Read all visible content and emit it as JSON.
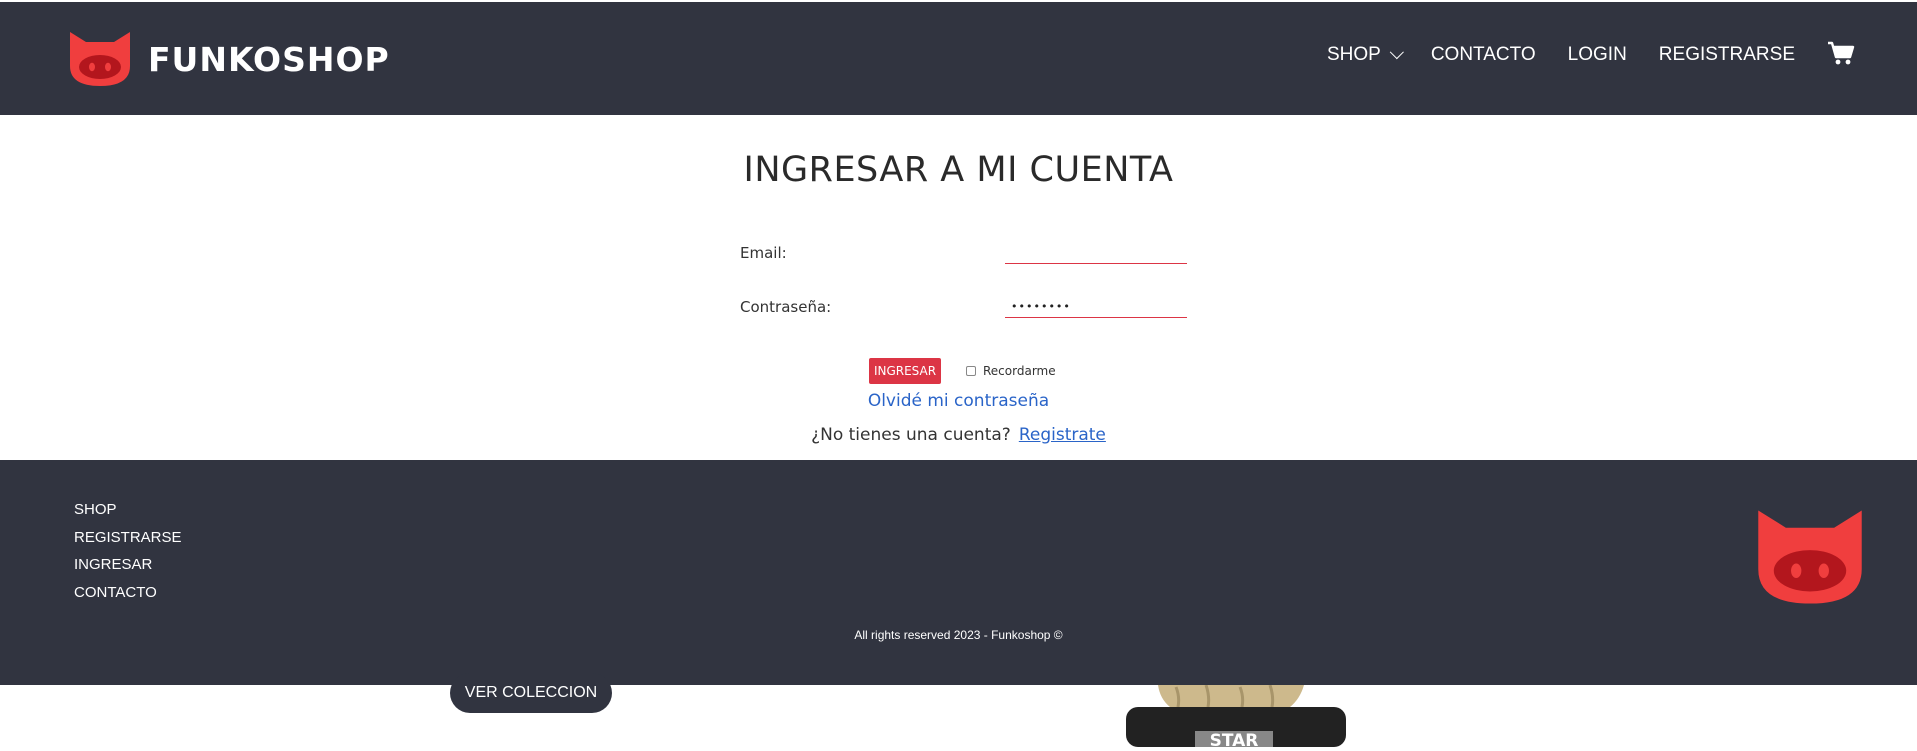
{
  "header": {
    "brand": "FUNKOSHOP",
    "nav": {
      "shop": "SHOP",
      "contacto": "CONTACTO",
      "login": "LOGIN",
      "registrarse": "REGISTRARSE"
    },
    "icons": {
      "logo": "cat-logo-icon",
      "cart": "cart-icon",
      "dropdown": "chevron-down-icon"
    }
  },
  "login": {
    "title": "INGRESAR A MI CUENTA",
    "email_label": "Email:",
    "email_value": "",
    "password_label": "Contraseña:",
    "password_value": "••••••••",
    "submit_label": "INGRESAR",
    "remember_label": "Recordarme",
    "remember_checked": false,
    "forgot_label": "Olvidé mi contraseña",
    "no_account_text": "¿No tienes una cuenta?",
    "register_link": "Registrate"
  },
  "footer": {
    "links": [
      "SHOP",
      "REGISTRARSE",
      "INGRESAR",
      "CONTACTO"
    ],
    "copyright": "All rights reserved 2023 - Funkoshop ©"
  },
  "below": {
    "collection_button": "VER COLECCION",
    "figure_label": "STAR"
  },
  "colors": {
    "dark": "#313440",
    "accent": "#dc3545",
    "logo_red": "#f03e3e",
    "link": "#2a64c8"
  }
}
